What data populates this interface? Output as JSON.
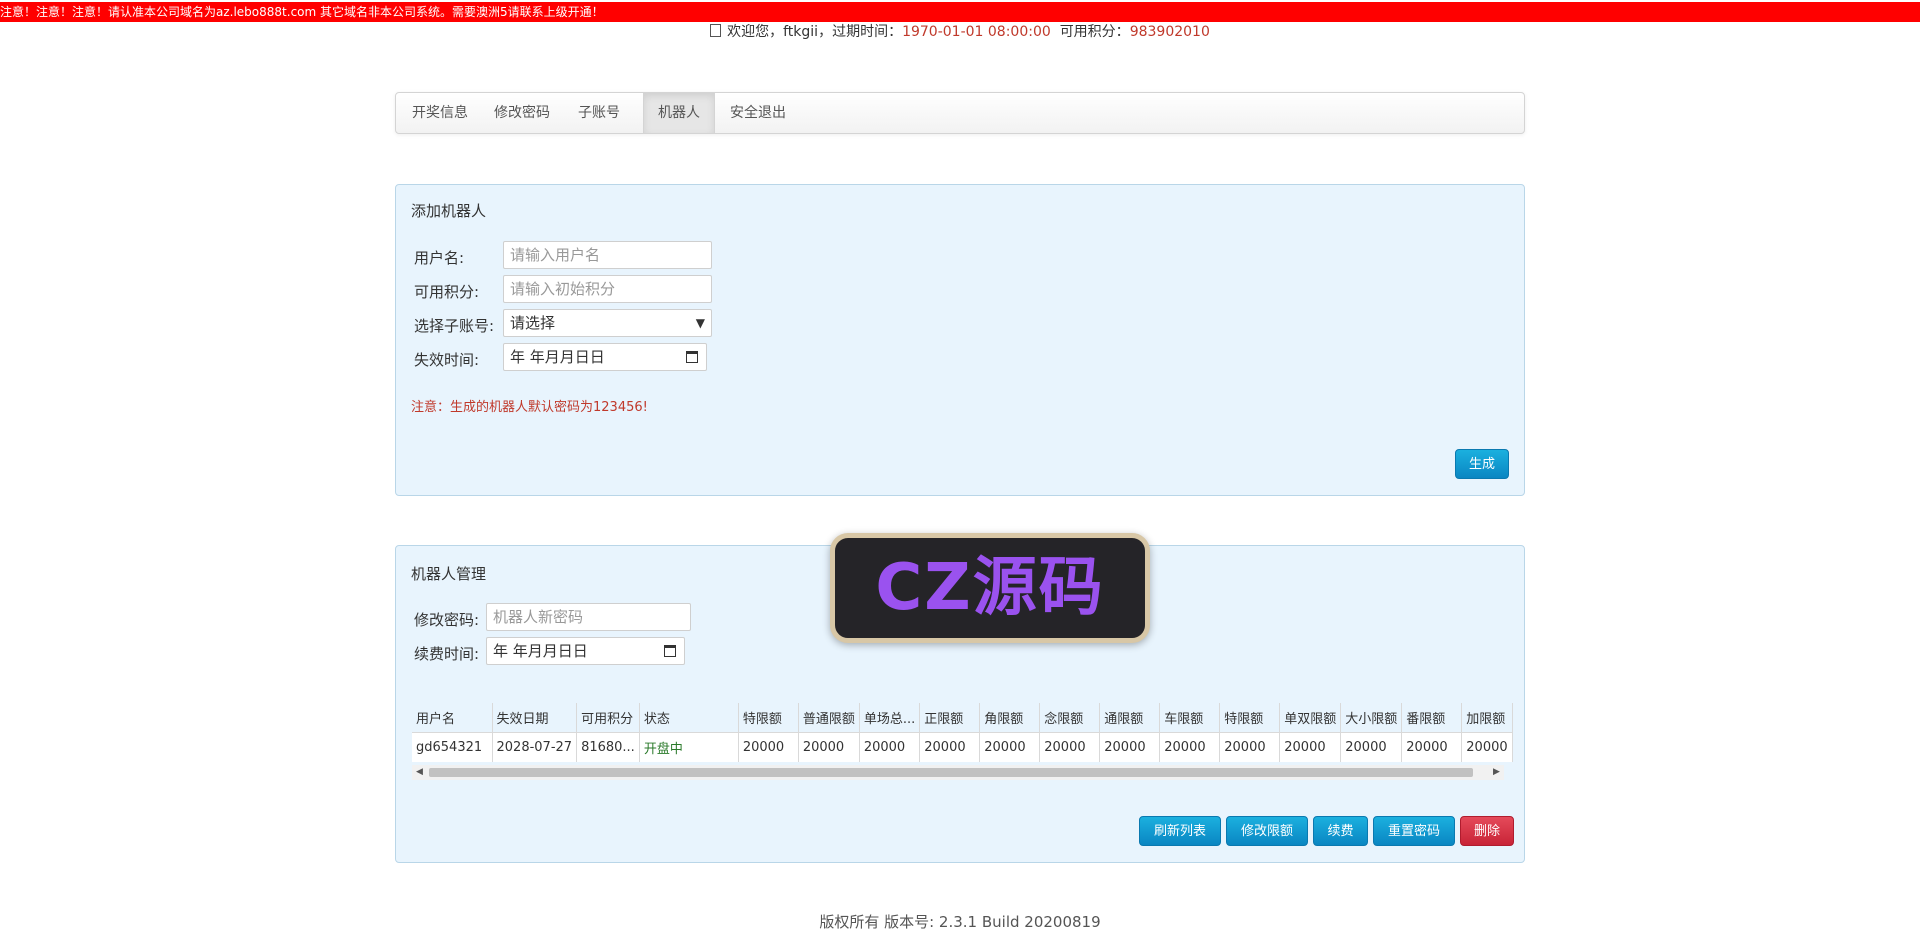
{
  "notice": "注意！注意！注意！请认准本公司域名为az.lebo888t.com 其它域名非本公司系统。需要澳洲5请联系上级开通！",
  "header": {
    "welcome_label": "欢迎您，ftkgii，过期时间：",
    "expire_time": "1970-01-01 08:00:00",
    "points_label": "可用积分：",
    "points_value": "983902010"
  },
  "nav": {
    "items": [
      "开奖信息",
      "修改密码",
      "子账号",
      "机器人",
      "安全退出"
    ],
    "active": "机器人"
  },
  "add_robot": {
    "title": "添加机器人",
    "username_label": "用户名:",
    "username_placeholder": "请输入用户名",
    "points_label": "可用积分:",
    "points_placeholder": "请输入初始积分",
    "subaccount_label": "选择子账号:",
    "subaccount_selected": "请选择",
    "expire_label": "失效时间:",
    "expire_value": "年 年月月日日",
    "warning": "注意：生成的机器人默认密码为123456!",
    "generate_button": "生成"
  },
  "manage_robot": {
    "title": "机器人管理",
    "password_label": "修改密码:",
    "password_placeholder": "机器人新密码",
    "renew_label": "续费时间:",
    "renew_value": "年 年月月日日",
    "table": {
      "headers": [
        "用户名",
        "失效日期",
        "可用积分",
        "状态",
        "特限额",
        "普通限额",
        "单场总...",
        "正限额",
        "角限额",
        "念限额",
        "通限额",
        "车限额",
        "特限额",
        "单双限额",
        "大小限额",
        "番限额",
        "加限额"
      ],
      "rows": [
        [
          "gd654321",
          "2028-07-27",
          "81680...",
          "开盘中",
          "20000",
          "20000",
          "20000",
          "20000",
          "20000",
          "20000",
          "20000",
          "20000",
          "20000",
          "20000",
          "20000",
          "20000",
          "20000"
        ]
      ]
    },
    "buttons": {
      "refresh": "刷新列表",
      "modify_limit": "修改限额",
      "renew": "续费",
      "reset_password": "重置密码",
      "delete": "删除"
    }
  },
  "footer": "版权所有 版本号: 2.3.1 Build 20200819",
  "watermark": "CZ源码"
}
